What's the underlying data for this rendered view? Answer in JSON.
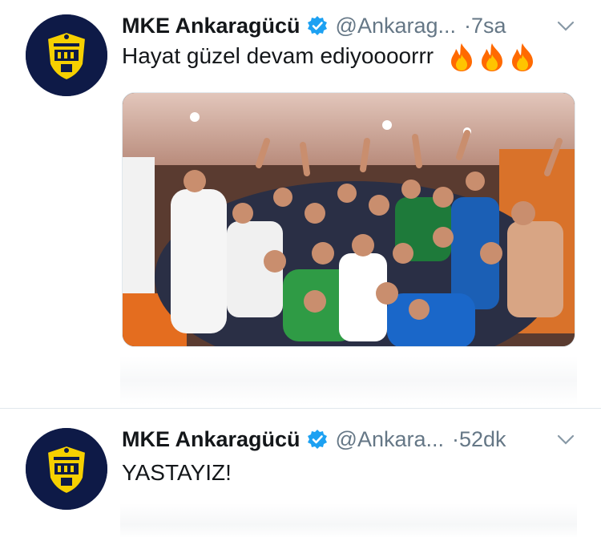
{
  "colors": {
    "text": "#14171a",
    "secondary": "#657786",
    "verified": "#1da1f2",
    "avatar_bg": "#0e1a47",
    "badge_yellow": "#f6d000",
    "fire": "#ff7a00"
  },
  "tweets": [
    {
      "author_name": "MKE Ankaragücü",
      "handle": "@Ankarag...",
      "time": "·7sa",
      "text": "Hayat güzel devam ediyoooorrr",
      "emoji_count": 3,
      "icons": {
        "verified": "verified-badge-icon",
        "menu": "chevron-down-icon",
        "emoji": "fire-icon"
      },
      "media": "team-celebration-photo"
    },
    {
      "author_name": "MKE Ankaragücü",
      "handle": "@Ankara...",
      "time": "·52dk",
      "text": "YASTAYIZ!",
      "icons": {
        "verified": "verified-badge-icon",
        "menu": "chevron-down-icon"
      }
    }
  ]
}
